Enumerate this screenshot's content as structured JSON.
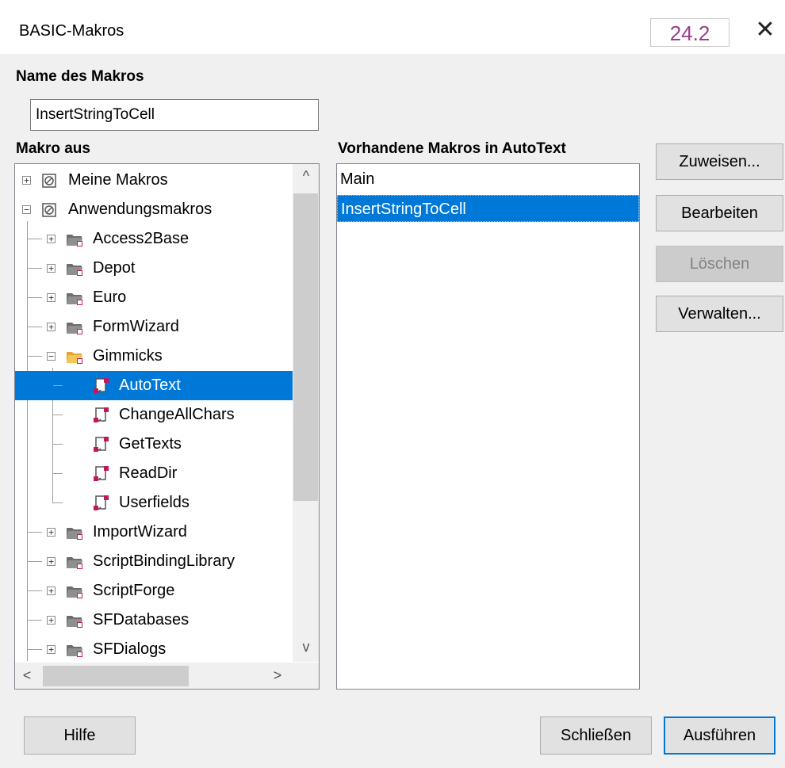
{
  "window": {
    "title": "BASIC-Makros",
    "version_badge": "24.2",
    "close_glyph": "✕"
  },
  "macro_name": {
    "label": "Name des Makros",
    "value": "InsertStringToCell"
  },
  "macro_from": {
    "label": "Makro aus",
    "tree": [
      {
        "label": "Meine Makros",
        "level": 0,
        "expander": "+",
        "icon": "library-icon"
      },
      {
        "label": "Anwendungsmakros",
        "level": 0,
        "expander": "−",
        "icon": "library-icon"
      },
      {
        "label": "Access2Base",
        "level": 1,
        "expander": "+",
        "icon": "folder-icon"
      },
      {
        "label": "Depot",
        "level": 1,
        "expander": "+",
        "icon": "folder-icon"
      },
      {
        "label": "Euro",
        "level": 1,
        "expander": "+",
        "icon": "folder-icon"
      },
      {
        "label": "FormWizard",
        "level": 1,
        "expander": "+",
        "icon": "folder-icon"
      },
      {
        "label": "Gimmicks",
        "level": 1,
        "expander": "−",
        "icon": "folder-open-icon"
      },
      {
        "label": "AutoText",
        "level": 2,
        "expander": "",
        "icon": "module-icon",
        "selected": true
      },
      {
        "label": "ChangeAllChars",
        "level": 2,
        "expander": "",
        "icon": "module-icon"
      },
      {
        "label": "GetTexts",
        "level": 2,
        "expander": "",
        "icon": "module-icon"
      },
      {
        "label": "ReadDir",
        "level": 2,
        "expander": "",
        "icon": "module-icon"
      },
      {
        "label": "Userfields",
        "level": 2,
        "expander": "",
        "icon": "module-icon"
      },
      {
        "label": "ImportWizard",
        "level": 1,
        "expander": "+",
        "icon": "folder-icon"
      },
      {
        "label": "ScriptBindingLibrary",
        "level": 1,
        "expander": "+",
        "icon": "folder-icon"
      },
      {
        "label": "ScriptForge",
        "level": 1,
        "expander": "+",
        "icon": "folder-icon"
      },
      {
        "label": "SFDatabases",
        "level": 1,
        "expander": "+",
        "icon": "folder-icon"
      },
      {
        "label": "SFDialogs",
        "level": 1,
        "expander": "+",
        "icon": "folder-icon"
      }
    ],
    "scroll_up": "^",
    "scroll_down": "v",
    "scroll_left": "<",
    "scroll_right": ">"
  },
  "existing_macros": {
    "label": "Vorhandene Makros in AutoText",
    "items": [
      {
        "label": "Main",
        "selected": false
      },
      {
        "label": "InsertStringToCell",
        "selected": true
      }
    ]
  },
  "buttons": {
    "assign": "Zuweisen...",
    "edit": "Bearbeiten",
    "delete": "Löschen",
    "manage": "Verwalten...",
    "help": "Hilfe",
    "close": "Schließen",
    "run": "Ausführen"
  },
  "colors": {
    "selection": "#0078d7",
    "badge_text": "#9b3c8d",
    "dialog_bg": "#f0f0f0"
  }
}
